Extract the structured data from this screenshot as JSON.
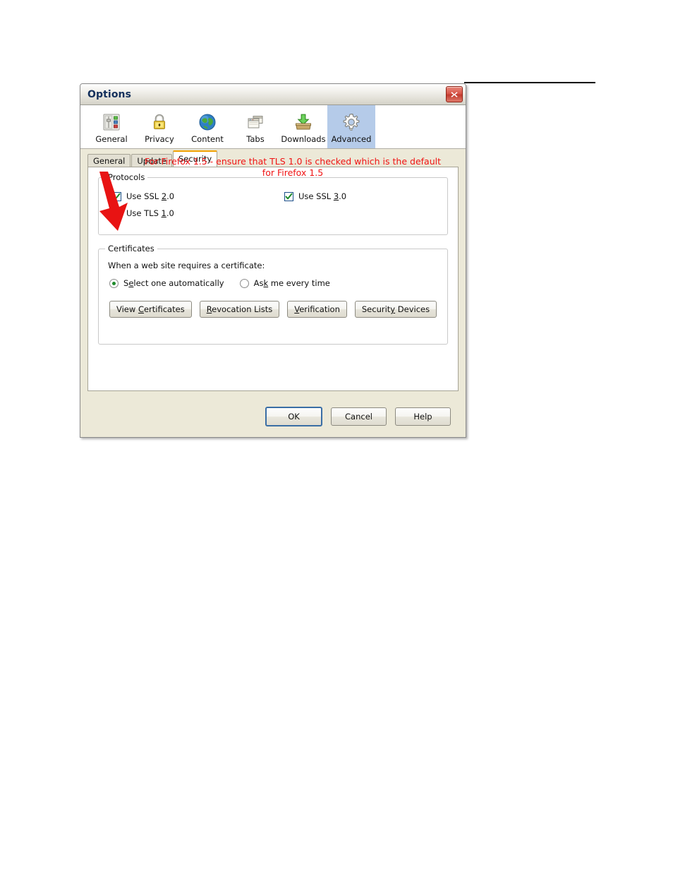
{
  "window": {
    "title": "Options",
    "close_icon": "close-icon"
  },
  "toolbar": {
    "items": [
      {
        "label": "General",
        "icon": "sliders-icon",
        "selected": false
      },
      {
        "label": "Privacy",
        "icon": "padlock-icon",
        "selected": false
      },
      {
        "label": "Content",
        "icon": "globe-icon",
        "selected": false
      },
      {
        "label": "Tabs",
        "icon": "windows-icon",
        "selected": false
      },
      {
        "label": "Downloads",
        "icon": "download-box-icon",
        "selected": false
      },
      {
        "label": "Advanced",
        "icon": "gear-icon",
        "selected": true
      }
    ]
  },
  "inner_tabs": [
    {
      "label": "General",
      "selected": false
    },
    {
      "label": "Update",
      "selected": false
    },
    {
      "label": "Security",
      "selected": true
    }
  ],
  "annotation": {
    "line1": "For Firefox 1.5 - ensure that TLS 1.0 is checked which is the default",
    "line2": "for Firefox 1.5",
    "color": "#f01414",
    "arrow": "red-down-arrow"
  },
  "protocols": {
    "group_title": "Protocols",
    "checkboxes": [
      {
        "label_pre": "Use SSL ",
        "accel": "2",
        "label_post": ".0",
        "checked": true,
        "column": "left"
      },
      {
        "label_pre": "Use SSL ",
        "accel": "3",
        "label_post": ".0",
        "checked": true,
        "column": "right"
      },
      {
        "label_pre": "Use TLS ",
        "accel": "1",
        "label_post": ".0",
        "checked": true,
        "column": "left"
      }
    ]
  },
  "certificates": {
    "group_title": "Certificates",
    "prompt": "When a web site requires a certificate:",
    "radios": [
      {
        "label_pre": "S",
        "accel": "e",
        "label_post": "lect one automatically",
        "selected": true
      },
      {
        "label_pre": "As",
        "accel": "k",
        "label_post": " me every time",
        "selected": false
      }
    ],
    "buttons": [
      {
        "label_pre": "View ",
        "accel": "C",
        "label_post": "ertificates"
      },
      {
        "label_pre": "",
        "accel": "R",
        "label_post": "evocation Lists"
      },
      {
        "label_pre": "",
        "accel": "V",
        "label_post": "erification"
      },
      {
        "label_pre": "Securit",
        "accel": "y",
        "label_post": " Devices"
      }
    ]
  },
  "footer": {
    "ok": "OK",
    "cancel": "Cancel",
    "help": "Help"
  },
  "colors": {
    "selected_tab_bg": "#b5cbe9",
    "dialog_bg": "#ece9d8",
    "title_text": "#14305c",
    "annotation_red": "#f01414",
    "check_green": "#1d8a2a",
    "tab_accent": "#f0a000"
  }
}
